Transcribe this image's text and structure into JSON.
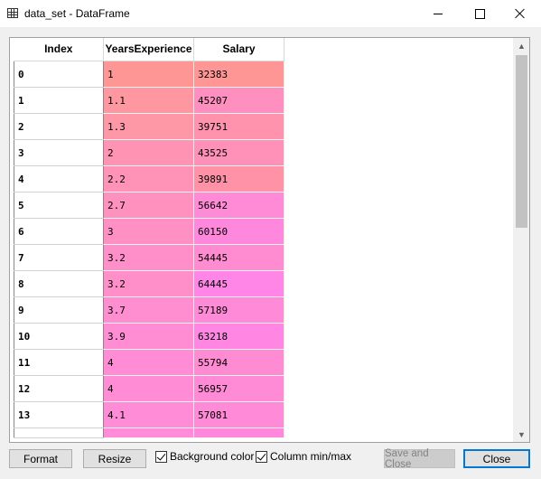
{
  "window": {
    "title": "data_set - DataFrame",
    "icon": "table-icon"
  },
  "table": {
    "columns": [
      "Index",
      "YearsExperience",
      "Salary"
    ],
    "rows": [
      {
        "index": "0",
        "years": "1",
        "salary": "32383",
        "years_color": "#ff9696",
        "salary_color": "#ff9696"
      },
      {
        "index": "1",
        "years": "1.1",
        "salary": "45207",
        "years_color": "#ff97a0",
        "salary_color": "#ff8fbe"
      },
      {
        "index": "2",
        "years": "1.3",
        "salary": "39751",
        "years_color": "#ff98a6",
        "salary_color": "#ff92ad"
      },
      {
        "index": "3",
        "years": "2",
        "salary": "43525",
        "years_color": "#ff93b4",
        "salary_color": "#ff90b8"
      },
      {
        "index": "4",
        "years": "2.2",
        "salary": "39891",
        "years_color": "#ff93b7",
        "salary_color": "#ff92a6"
      },
      {
        "index": "5",
        "years": "2.7",
        "salary": "56642",
        "years_color": "#ff91bf",
        "salary_color": "#ff8ad6"
      },
      {
        "index": "6",
        "years": "3",
        "salary": "60150",
        "years_color": "#ff90c4",
        "salary_color": "#ff88dd"
      },
      {
        "index": "7",
        "years": "3.2",
        "salary": "54445",
        "years_color": "#ff8fc8",
        "salary_color": "#ff8cd0"
      },
      {
        "index": "8",
        "years": "3.2",
        "salary": "64445",
        "years_color": "#ff8fc8",
        "salary_color": "#ff86e6"
      },
      {
        "index": "9",
        "years": "3.7",
        "salary": "57189",
        "years_color": "#ff8ed0",
        "salary_color": "#ff8ad7"
      },
      {
        "index": "10",
        "years": "3.9",
        "salary": "63218",
        "years_color": "#ff8dd3",
        "salary_color": "#ff86e3"
      },
      {
        "index": "11",
        "years": "4",
        "salary": "55794",
        "years_color": "#ff8cd5",
        "salary_color": "#ff8bd3"
      },
      {
        "index": "12",
        "years": "4",
        "salary": "56957",
        "years_color": "#ff8cd5",
        "salary_color": "#ff8ad6"
      },
      {
        "index": "13",
        "years": "4.1",
        "salary": "57081",
        "years_color": "#ff8cd7",
        "salary_color": "#ff8ad7"
      }
    ],
    "overflow_row": {
      "years_color": "#ff8bd9",
      "salary_color": "#ff88dc"
    }
  },
  "toolbar": {
    "format_label": "Format",
    "resize_label": "Resize",
    "background_color_label": "Background color",
    "background_color_checked": true,
    "column_minmax_label": "Column min/max",
    "column_minmax_checked": true,
    "save_close_label": "Save and Close",
    "close_label": "Close"
  },
  "scrollbar": {
    "up_icon": "chevron-up-icon",
    "down_icon": "chevron-down-icon"
  }
}
